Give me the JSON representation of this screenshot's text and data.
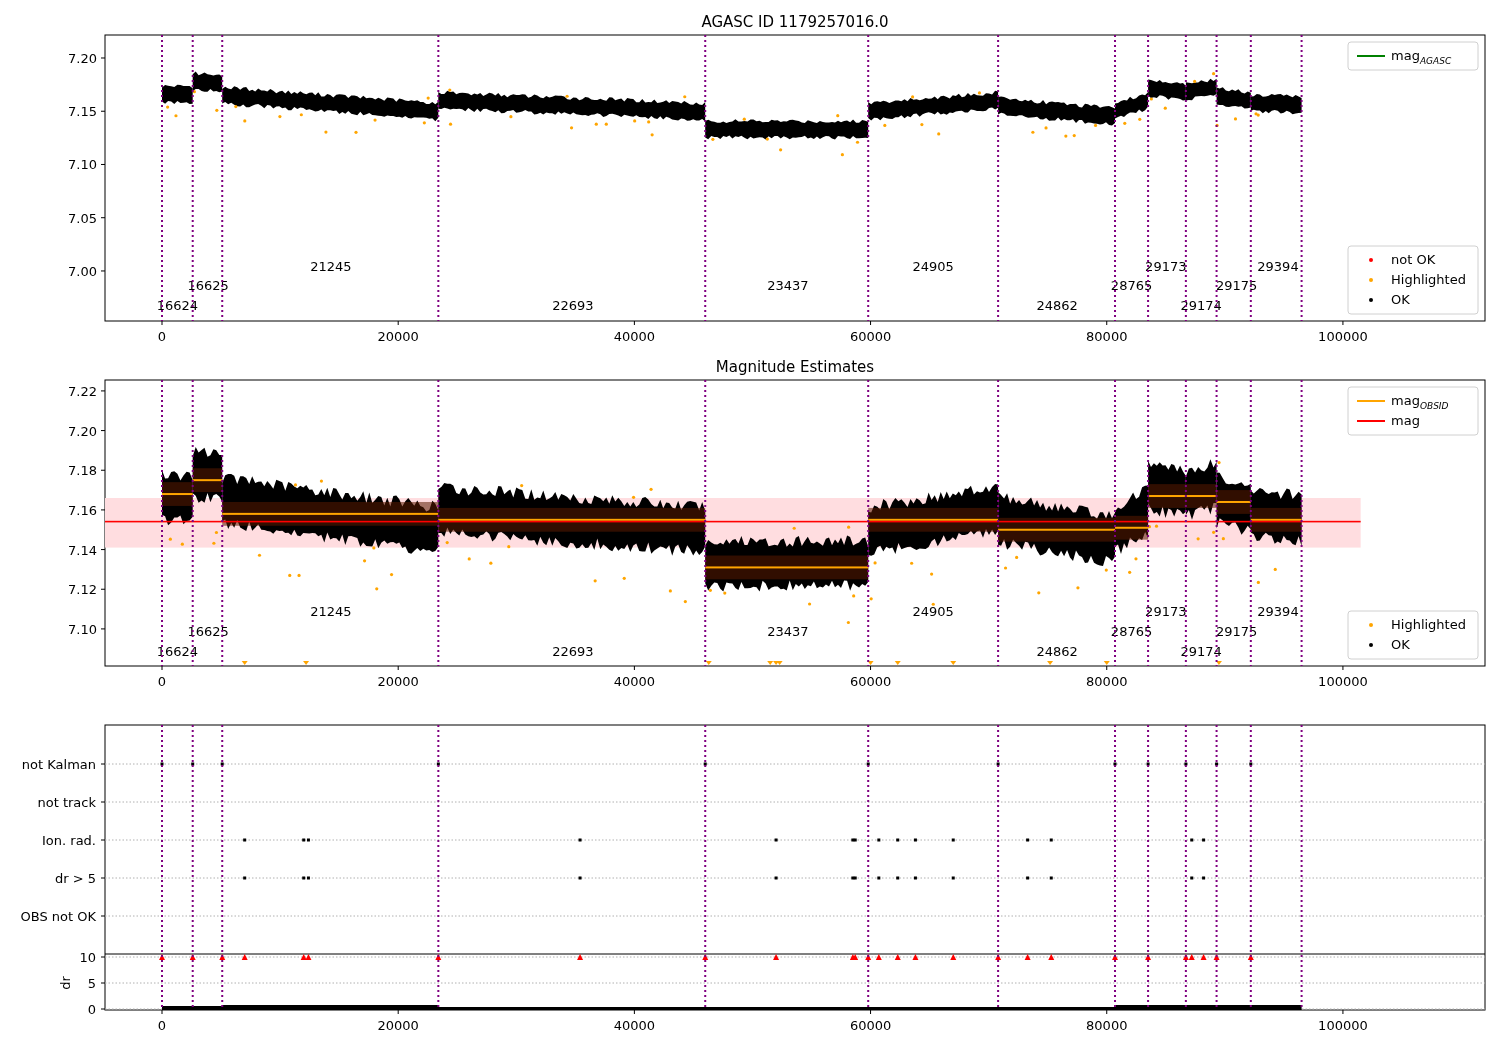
{
  "panels": [
    {
      "kind": "magnitudes",
      "title": "AGASC ID 1179257016.0",
      "xtick_labels": [
        "0",
        "20000",
        "40000",
        "60000",
        "80000",
        "100000"
      ],
      "ytick_labels": [
        "7.20",
        "7.15",
        "7.10",
        "7.05",
        "7.00"
      ],
      "obsid_labels": [
        "16624",
        "16625",
        "21245",
        "22693",
        "23437",
        "24905",
        "24862",
        "28765",
        "29173",
        "29174",
        "29175",
        "29394"
      ],
      "legends": [
        {
          "entries": [
            {
              "kind": "line",
              "color": "#008000",
              "label": "mag$_{AGASC}$"
            }
          ]
        },
        {
          "entries": [
            {
              "kind": "dot",
              "color": "#ff0000",
              "label": "not OK"
            },
            {
              "kind": "dot",
              "color": "#ffa500",
              "label": "Highlighted"
            },
            {
              "kind": "dot",
              "color": "#000000",
              "label": "OK"
            }
          ]
        }
      ]
    },
    {
      "kind": "estimates",
      "title": "Magnitude Estimates",
      "xtick_labels": [
        "0",
        "20000",
        "40000",
        "60000",
        "80000",
        "100000"
      ],
      "ytick_labels": [
        "7.22",
        "7.20",
        "7.18",
        "7.16",
        "7.14",
        "7.12",
        "7.10"
      ],
      "obsid_labels": [
        "16624",
        "16625",
        "21245",
        "22693",
        "23437",
        "24905",
        "24862",
        "28765",
        "29173",
        "29174",
        "29175",
        "29394"
      ],
      "legends": [
        {
          "entries": [
            {
              "kind": "line",
              "color": "#ffa500",
              "label": "mag$_{OBSID}$"
            },
            {
              "kind": "line",
              "color": "#ff0000",
              "label": "mag"
            }
          ]
        },
        {
          "entries": [
            {
              "kind": "dot",
              "color": "#ffa500",
              "label": "Highlighted"
            },
            {
              "kind": "dot",
              "color": "#000000",
              "label": "OK"
            }
          ]
        }
      ]
    },
    {
      "kind": "flags",
      "xtick_labels": [
        "0",
        "20000",
        "40000",
        "60000",
        "80000",
        "100000"
      ],
      "category_labels": [
        "not Kalman",
        "not track",
        "Ion. rad.",
        "dr > 5",
        "OBS not OK"
      ],
      "ytick_labels": [
        "10",
        "5",
        "0"
      ],
      "ylabel": "dr"
    }
  ]
}
